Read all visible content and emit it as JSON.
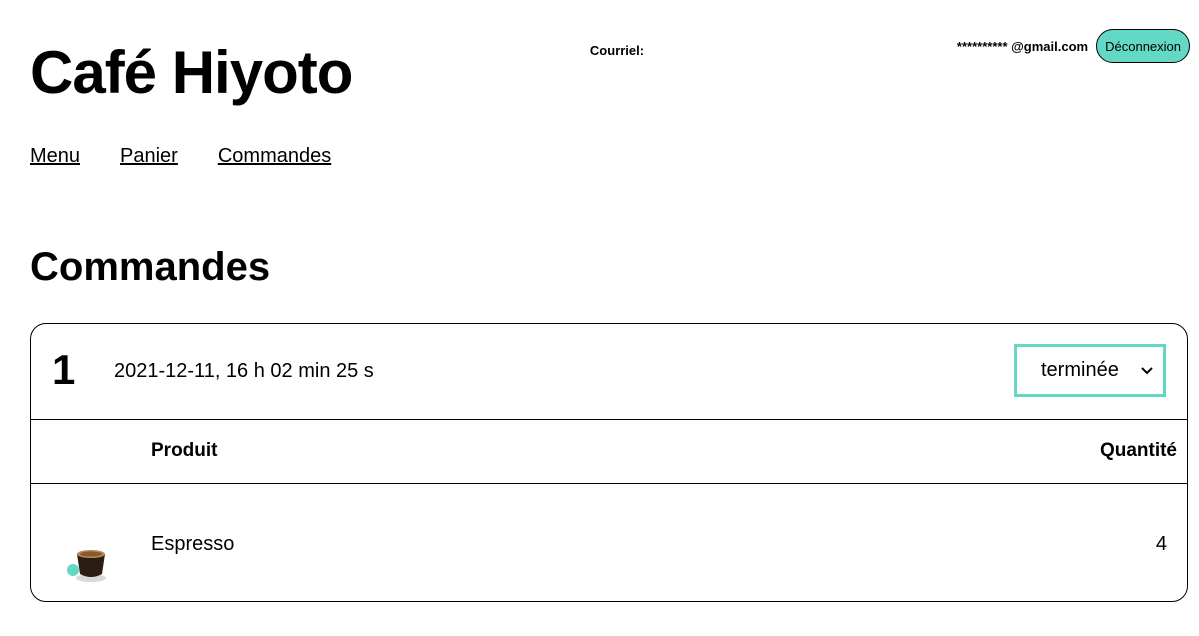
{
  "header": {
    "site_title": "Café Hiyoto",
    "email_label": "Courriel:",
    "email_value": "********** @gmail.com",
    "logout_label": "Déconnexion"
  },
  "nav": {
    "items": [
      {
        "label": "Menu"
      },
      {
        "label": "Panier"
      },
      {
        "label": "Commandes"
      }
    ]
  },
  "main": {
    "title": "Commandes",
    "orders": [
      {
        "number": "1",
        "datetime": "2021-12-11, 16 h 02 min 25 s",
        "status": "terminée",
        "columns": {
          "product": "Produit",
          "quantity": "Quantité"
        },
        "items": [
          {
            "name": "Espresso",
            "quantity": "4",
            "icon": "espresso-cup-image"
          }
        ]
      }
    ]
  },
  "colors": {
    "accent": "#63d9c5"
  }
}
